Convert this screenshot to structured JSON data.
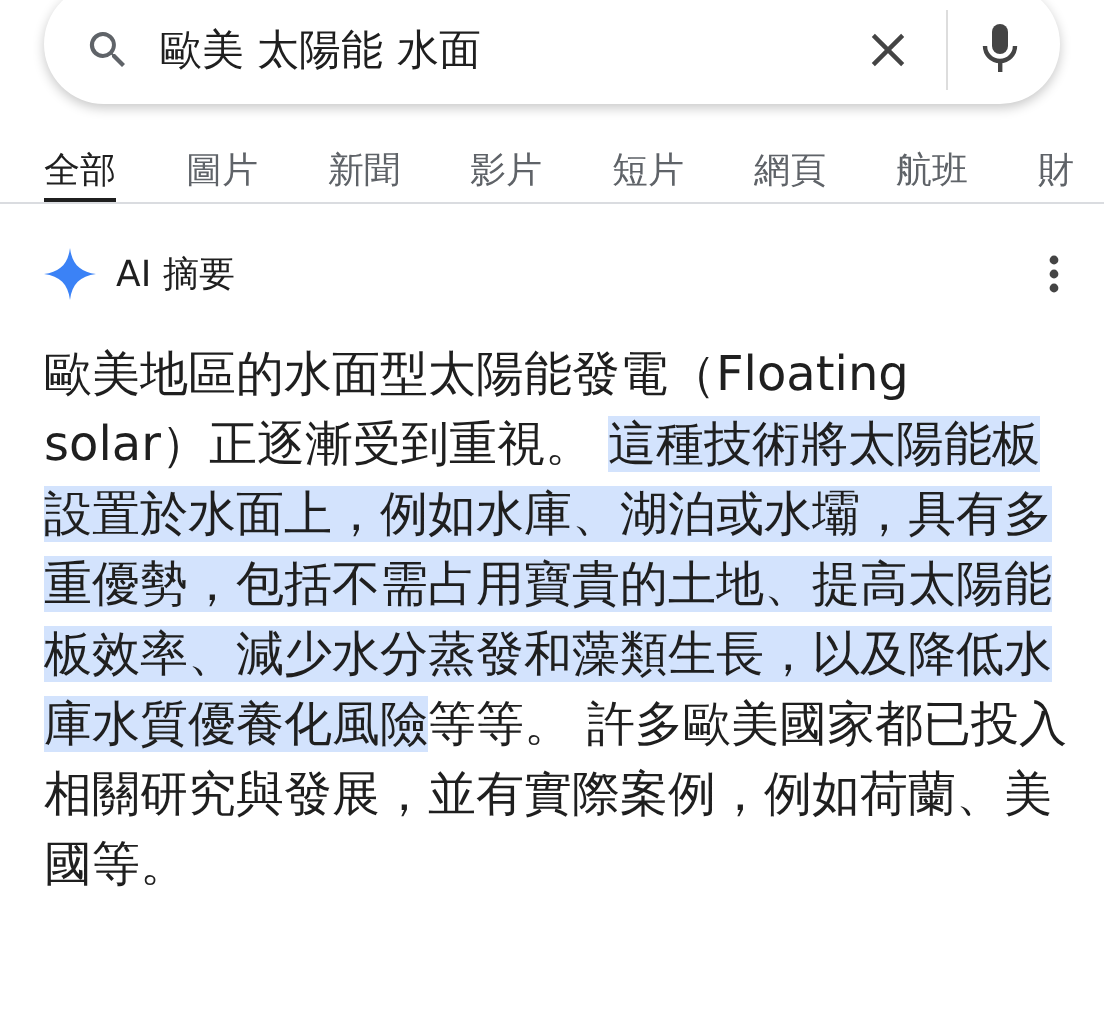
{
  "search": {
    "value": "歐美 太陽能 水面"
  },
  "tabs": [
    {
      "label": "全部",
      "selected": true
    },
    {
      "label": "圖片",
      "selected": false
    },
    {
      "label": "新聞",
      "selected": false
    },
    {
      "label": "影片",
      "selected": false
    },
    {
      "label": "短片",
      "selected": false
    },
    {
      "label": "網頁",
      "selected": false
    },
    {
      "label": "航班",
      "selected": false
    },
    {
      "label": "財",
      "selected": false
    }
  ],
  "ai_overview": {
    "title": "AI 摘要",
    "paragraph": [
      {
        "text": "歐美地區的水面型太陽能發電（Floating solar）正逐漸受到重視。 ",
        "highlighted": false
      },
      {
        "text": "這種技術將太陽能板設置於水面上，例如水庫、湖泊或水壩，具有多重優勢，包括不需占用寶貴的土地、提高太陽能板效率、減少水分蒸發和藻類生長，以及降低水庫水質優養化風險",
        "highlighted": true
      },
      {
        "text": "等等。 許多歐美國家都已投入相關研究與發展，並有實際案例，例如荷蘭、美國等。",
        "highlighted": false
      }
    ]
  }
}
